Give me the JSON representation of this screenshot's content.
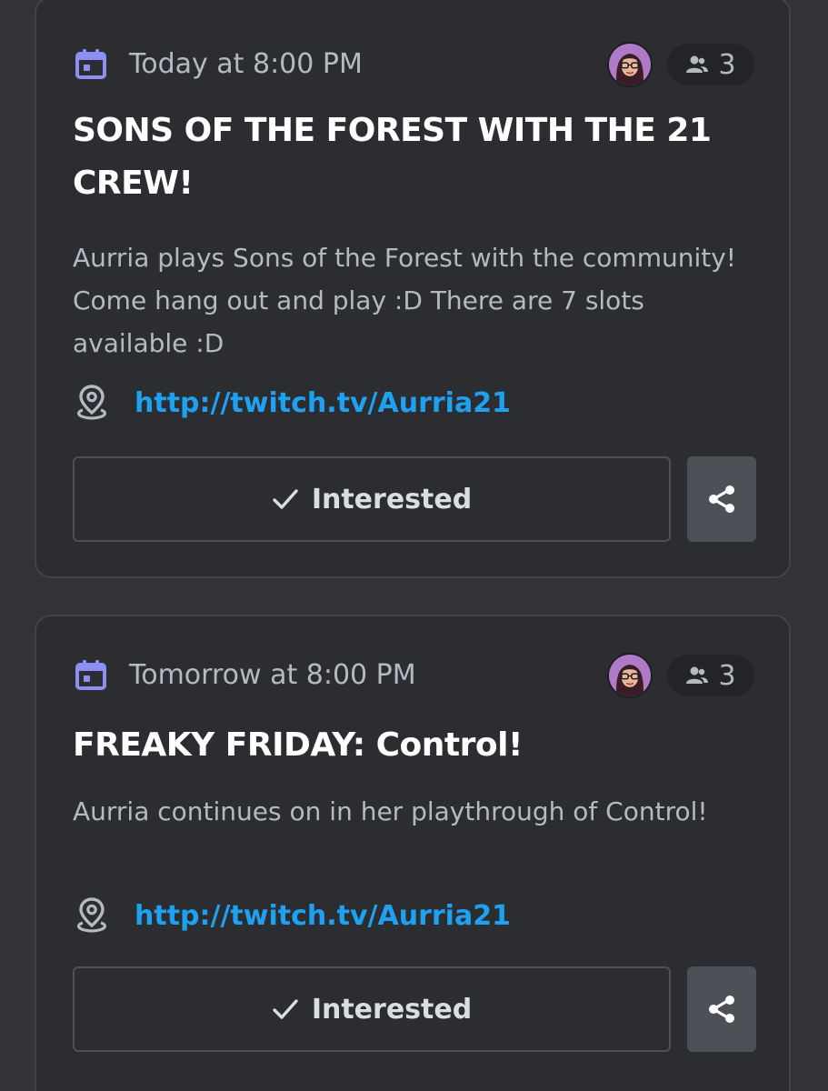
{
  "colors": {
    "background": "#313338",
    "card_border": "#41434a",
    "title": "#ffffff",
    "muted_text": "#b5bac1",
    "link": "#1ea1f1",
    "calendar_icon": "#8b8ef5",
    "share_button_bg": "#4e5058"
  },
  "events": [
    {
      "time": "Today at 8:00 PM",
      "interested_count": "3",
      "title": "SONS OF THE FOREST WITH THE 21 CREW!",
      "description": "Aurria plays Sons of the Forest with the community! Come hang out and play :D There are 7 slots available :D",
      "location_link": "http://twitch.tv/Aurria21",
      "interested_label": "Interested",
      "icons": {
        "date": "calendar-icon",
        "count": "people-icon",
        "location": "location-pin-icon",
        "check": "checkmark-icon",
        "share": "share-icon"
      }
    },
    {
      "time": "Tomorrow at 8:00 PM",
      "interested_count": "3",
      "title": "FREAKY FRIDAY: Control!",
      "description": "Aurria continues on in her playthrough of Control!",
      "location_link": "http://twitch.tv/Aurria21",
      "interested_label": "Interested",
      "icons": {
        "date": "calendar-icon",
        "count": "people-icon",
        "location": "location-pin-icon",
        "check": "checkmark-icon",
        "share": "share-icon"
      }
    }
  ]
}
